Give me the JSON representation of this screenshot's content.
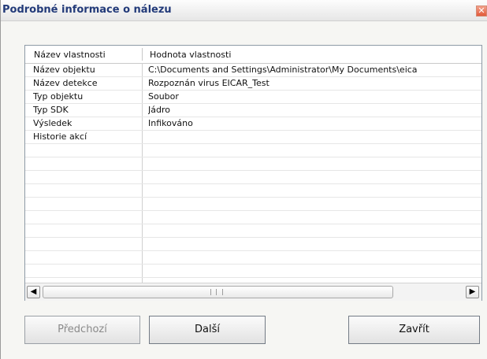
{
  "window": {
    "title": "Podrobné informace o nálezu",
    "close_glyph": "✕"
  },
  "table": {
    "columns": [
      "Název vlastnosti",
      "Hodnota vlastnosti"
    ],
    "rows": [
      {
        "name": "Název objektu",
        "value": "C:\\Documents and Settings\\Administrator\\My Documents\\eica"
      },
      {
        "name": "Název detekce",
        "value": "Rozpoznán virus EICAR_Test"
      },
      {
        "name": "Typ objektu",
        "value": "Soubor"
      },
      {
        "name": "Typ SDK",
        "value": "Jádro"
      },
      {
        "name": "Výsledek",
        "value": "Infikováno"
      },
      {
        "name": "Historie akcí",
        "value": ""
      }
    ]
  },
  "scrollbar": {
    "left_arrow": "◀",
    "right_arrow": "▶"
  },
  "buttons": {
    "previous": "Předchozí",
    "next": "Další",
    "close": "Zavřít"
  }
}
